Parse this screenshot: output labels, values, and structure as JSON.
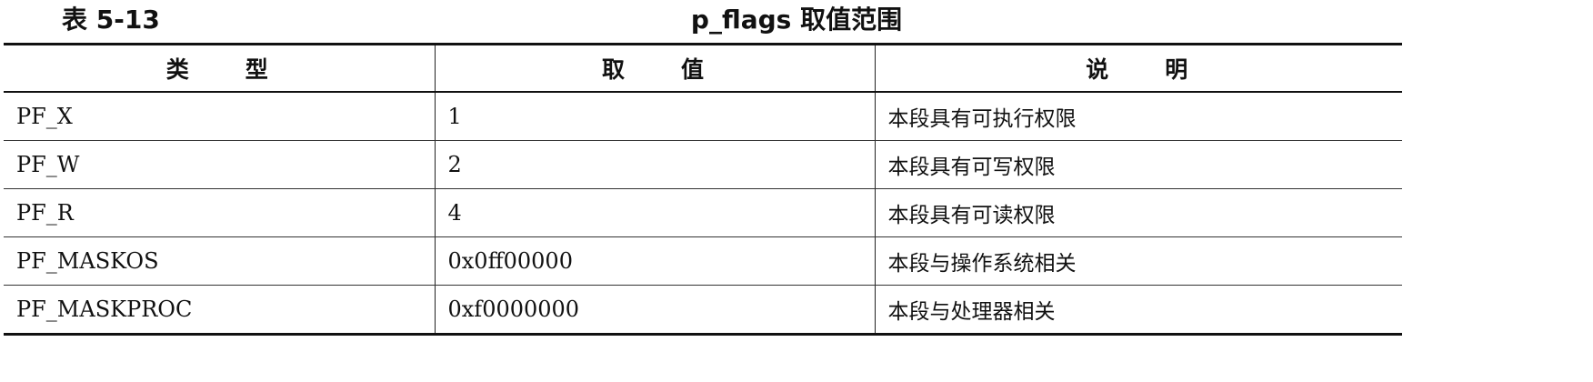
{
  "caption": {
    "number": "表 5-13",
    "title": "p_flags 取值范围"
  },
  "table": {
    "headers": [
      "类　　型",
      "取　　值",
      "说　　明"
    ],
    "rows": [
      {
        "type": "PF_X",
        "value": "1",
        "desc": "本段具有可执行权限"
      },
      {
        "type": "PF_W",
        "value": "2",
        "desc": "本段具有可写权限"
      },
      {
        "type": "PF_R",
        "value": "4",
        "desc": "本段具有可读权限"
      },
      {
        "type": "PF_MASKOS",
        "value": "0x0ff00000",
        "desc": "本段与操作系统相关"
      },
      {
        "type": "PF_MASKPROC",
        "value": "0xf0000000",
        "desc": "本段与处理器相关"
      }
    ]
  }
}
